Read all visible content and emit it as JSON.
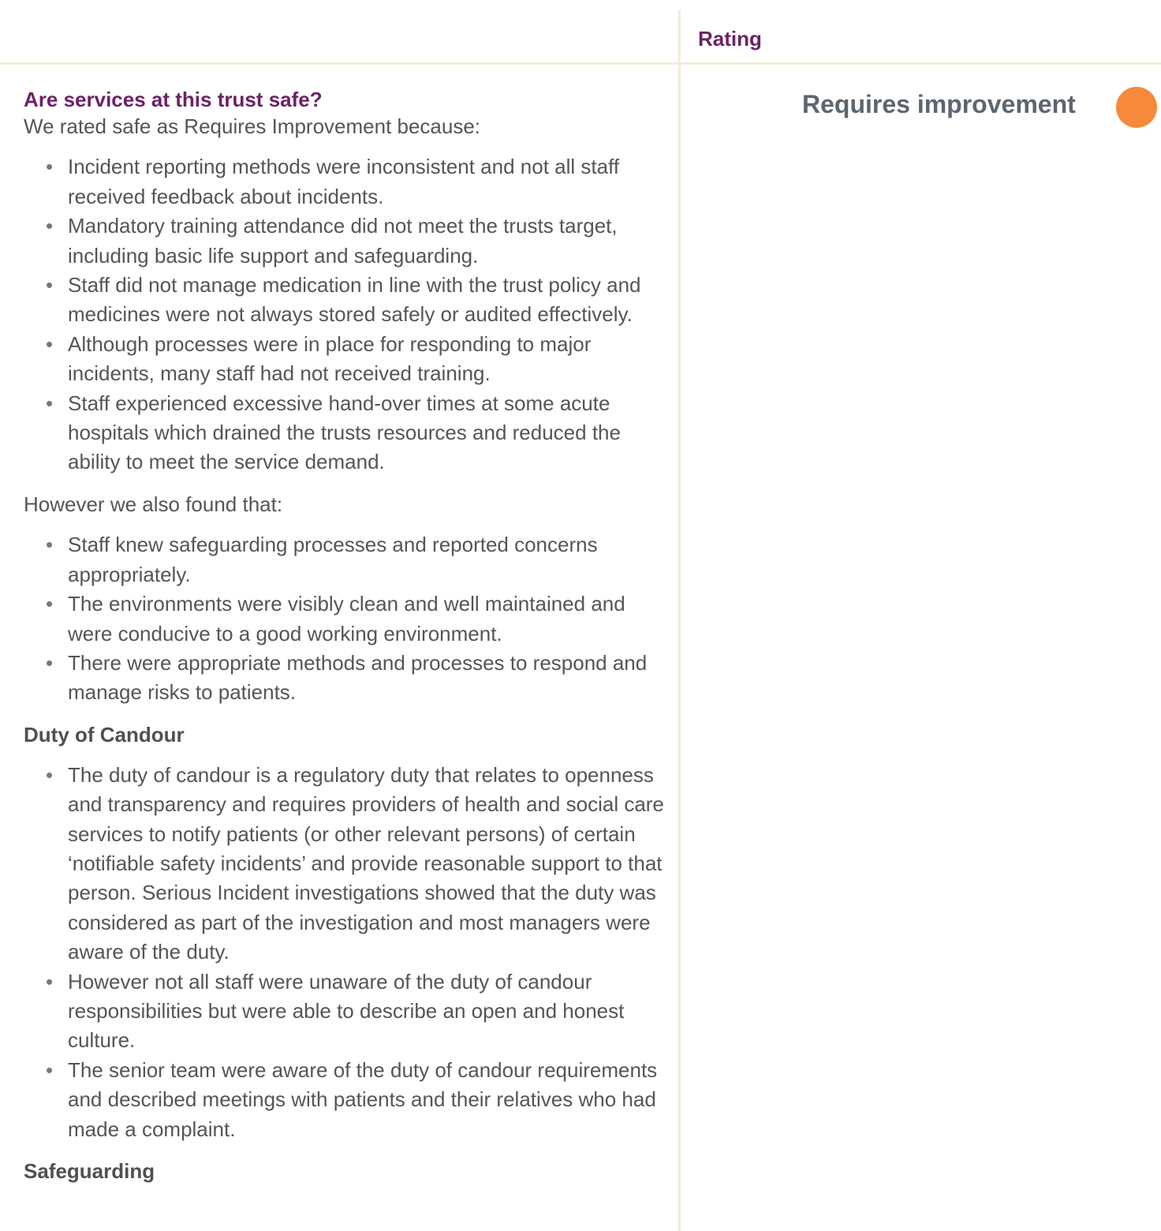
{
  "header": {
    "rating_label": "Rating"
  },
  "rating": {
    "value": "Requires improvement",
    "color": "#f6893a"
  },
  "section": {
    "title": "Are services at this trust safe?",
    "intro": "We rated safe as Requires Improvement because:",
    "bullets": [
      "Incident reporting methods were inconsistent and not all staff received feedback about incidents.",
      "Mandatory training attendance did not meet the trusts target, including basic life support and safeguarding.",
      "Staff did not manage medication in line with the trust policy and medicines were not always stored safely or audited effectively.",
      "Although processes were in place for responding to major incidents, many staff had not received training.",
      "Staff experienced excessive hand-over times at some acute hospitals which drained the trusts resources and reduced the ability to meet the service demand."
    ],
    "however_intro": "However we also found that:",
    "however_bullets": [
      "Staff knew safeguarding processes and reported concerns appropriately.",
      "The environments were visibly clean and well maintained and were conducive to a good working environment.",
      "There were appropriate methods and processes to respond and manage risks to patients."
    ]
  },
  "duty_of_candour": {
    "heading": "Duty of Candour",
    "bullets": [
      "The duty of candour is a regulatory duty that relates to openness and transparency and requires providers of health and social care services to notify patients (or other relevant persons) of certain ‘notifiable safety incidents’ and provide reasonable support to that person. Serious Incident investigations showed that the duty was considered as part of the investigation and most managers were aware of the duty.",
      "However not all staff were unaware of the duty of candour responsibilities but were able to describe an open and honest culture.",
      "The senior team were aware of the duty of candour requirements and described meetings with patients and their relatives who had made a complaint."
    ]
  },
  "safeguarding": {
    "heading": "Safeguarding"
  }
}
